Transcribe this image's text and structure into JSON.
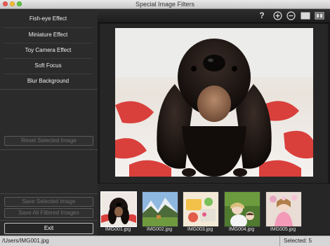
{
  "window": {
    "title": "Special Image Filters"
  },
  "sidebar": {
    "effects": [
      {
        "label": "Fish-eye Effect"
      },
      {
        "label": "Miniature Effect"
      },
      {
        "label": "Toy Camera Effect"
      },
      {
        "label": "Soft Focus"
      },
      {
        "label": "Blur Background"
      }
    ],
    "reset_label": "Reset Selected Image",
    "save_selected_label": "Save Selected Image",
    "save_all_label": "Save All Filtered Images",
    "exit_label": "Exit"
  },
  "toolbar": {
    "help_icon": "question-mark-icon",
    "zoom_in_icon": "zoom-in-icon",
    "zoom_out_icon": "zoom-out-icon",
    "full_screen_icon": "full-screen-view-icon",
    "compare_icon": "compare-view-icon"
  },
  "preview": {
    "image": "dachshund-closeup"
  },
  "thumbnails": [
    {
      "filename": "IMG001.jpg",
      "selected": true
    },
    {
      "filename": "IMG002.jpg",
      "selected": false
    },
    {
      "filename": "IMG003.jpg",
      "selected": false
    },
    {
      "filename": "IMG004.jpg",
      "selected": false
    },
    {
      "filename": "IMG005.jpg",
      "selected": false
    }
  ],
  "status": {
    "path": "/Users/IMG001.jpg",
    "selected": "Selected: 5"
  },
  "colors": {
    "selection_border": "#ffffff",
    "sidebar_bg": "#2b2b2b",
    "main_bg": "#181818"
  }
}
